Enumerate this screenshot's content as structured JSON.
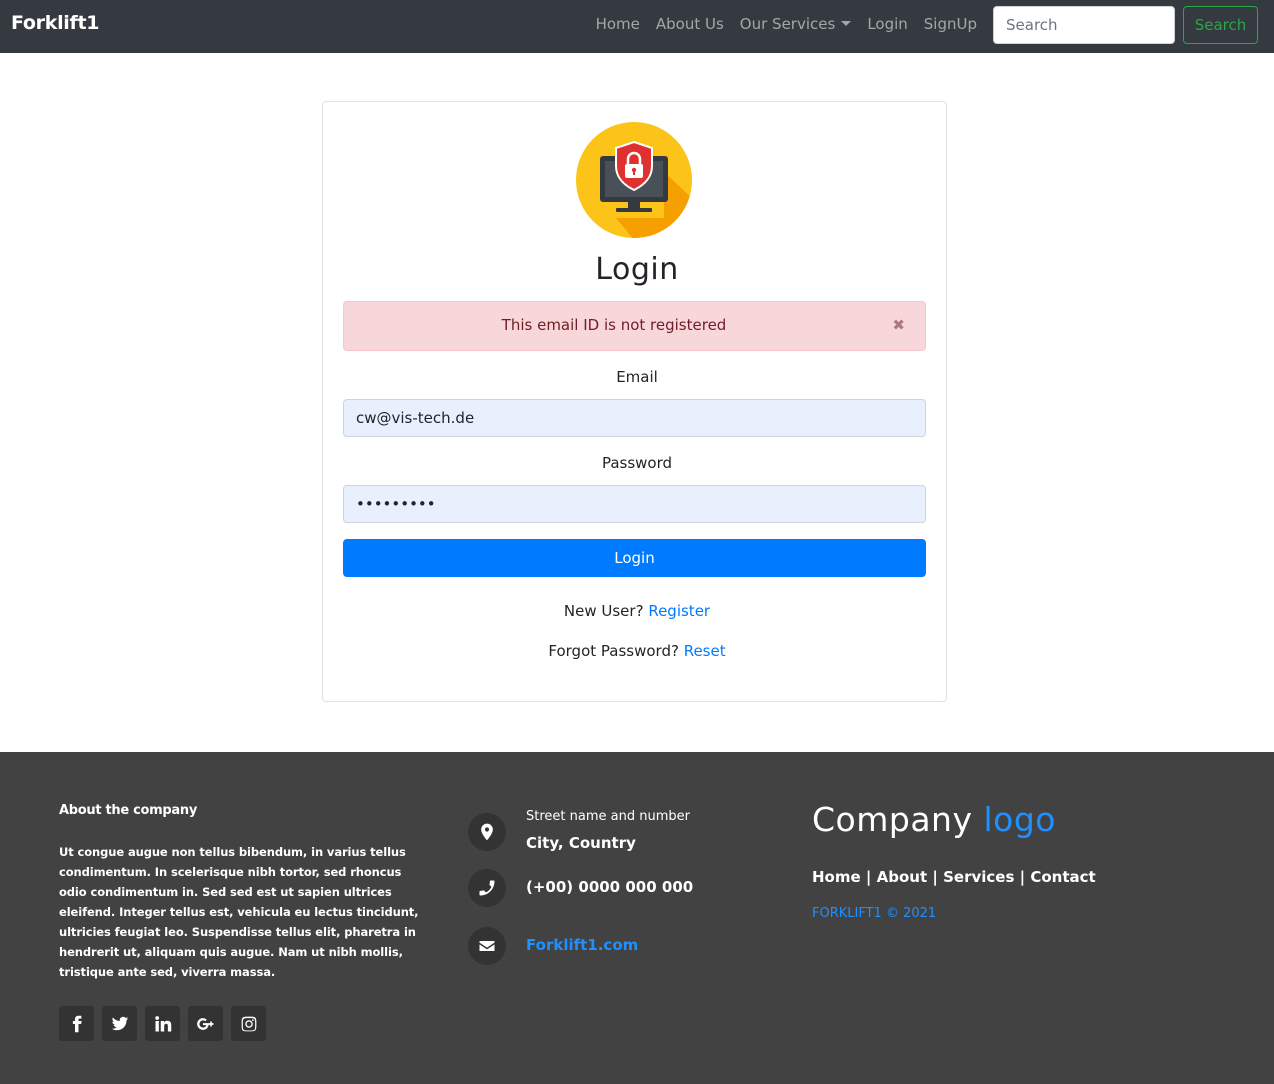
{
  "navbar": {
    "brand": "Forklift1",
    "links": {
      "home": "Home",
      "about": "About Us",
      "services": "Our Services",
      "login": "Login",
      "signup": "SignUp"
    },
    "search_placeholder": "Search",
    "search_button": "Search"
  },
  "login": {
    "title": "Login",
    "alert": "This email ID is not registered",
    "alert_close": "✖",
    "email_label": "Email",
    "email_value": "cw@vis-tech.de",
    "password_label": "Password",
    "password_value": "123456789",
    "button": "Login",
    "new_user_text": "New User?",
    "register_link": "Register",
    "forgot_text": "Forgot Password?",
    "reset_link": "Reset"
  },
  "footer": {
    "about_title": "About the company",
    "about_text": "Ut congue augue non tellus bibendum, in varius tellus condimentum. In scelerisque nibh tortor, sed rhoncus odio condimentum in. Sed sed est ut sapien ultrices eleifend. Integer tellus est, vehicula eu lectus tincidunt, ultricies feugiat leo. Suspendisse tellus elit, pharetra in hendrerit ut, aliquam quis augue. Nam ut nibh mollis, tristique ante sed, viverra massa.",
    "street": "Street name and number",
    "city": "City, Country",
    "phone": "(+00) 0000 000 000",
    "email": "Forklift1.com",
    "logo_main": "Company",
    "logo_accent": "logo",
    "links": {
      "home": "Home",
      "about": "About",
      "services": "Services",
      "contact": "Contact"
    },
    "separator": "|",
    "copyright": "FORKLIFT1 © 2021"
  },
  "icons": {
    "lock": "monitor-lock-icon",
    "location": "map-marker-icon",
    "phone": "phone-icon",
    "email": "envelope-icon",
    "socials": [
      "facebook-icon",
      "twitter-icon",
      "linkedin-icon",
      "google-plus-icon",
      "instagram-icon"
    ]
  },
  "colors": {
    "navbar_bg": "#343a40",
    "primary": "#007bff",
    "success": "#28a745",
    "alert_bg": "#f8d7da",
    "footer_bg": "#424242",
    "accent_blue": "#1e90ff",
    "icon_yellow": "#fcc419"
  }
}
